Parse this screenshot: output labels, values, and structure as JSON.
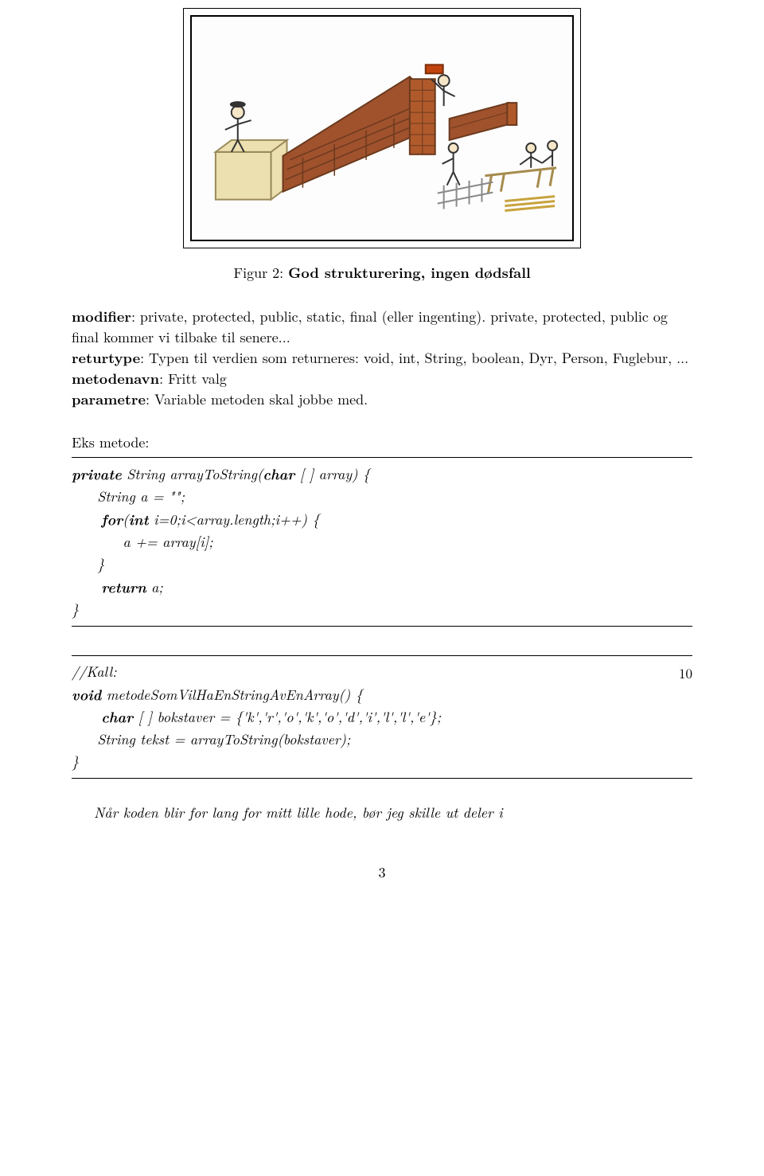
{
  "figure": {
    "caption_label": "Figur 2:",
    "caption_text": "God strukturering, ingen dødsfall"
  },
  "definitions": {
    "modifier_term": "modifier",
    "modifier_text": ": private, protected, public, static, final (eller ingenting). private, protected, public og final kommer vi tilbake til senere...",
    "returtype_term": "returtype",
    "returtype_text": ": Typen til verdien som returneres: void, int, String, boolean, Dyr, Person, Fuglebur, ...",
    "metodenavn_term": "metodenavn",
    "metodenavn_text": ": Fritt valg",
    "parametre_term": "parametre",
    "parametre_text": ": Variable metoden skal jobbe med."
  },
  "example_intro": "Eks metode:",
  "code1": {
    "l1_kw1": "private",
    "l1_rest": " String arrayToString(",
    "l1_kw2": "char",
    "l1_rest2": " [ ] array) {",
    "l2": "     String a = \"\";",
    "l3_kw": "     for",
    "l3_rest": "(",
    "l3_kw2": "int",
    "l3_rest2": " i=0;i<array.length;i++) {",
    "l4": "          a += array[i];",
    "l5": "     }",
    "l6_kw": "     return",
    "l6_rest": " a;",
    "l7": "}"
  },
  "code2": {
    "linenum": "10",
    "l1_comment": "//Kall:",
    "l2_kw": "void",
    "l2_rest": " metodeSomVilHaEnStringAvEnArray() {",
    "l3_kw": "     char",
    "l3_rest": " [ ] bokstaver = {'k','r','o','k','o','d','i','l','l','e'};",
    "l4": "     String tekst = arrayToString(bokstaver);",
    "l5": "}"
  },
  "closing": "Når koden blir for lang for mitt lille hode, bør jeg skille ut deler i",
  "page_number": "3"
}
